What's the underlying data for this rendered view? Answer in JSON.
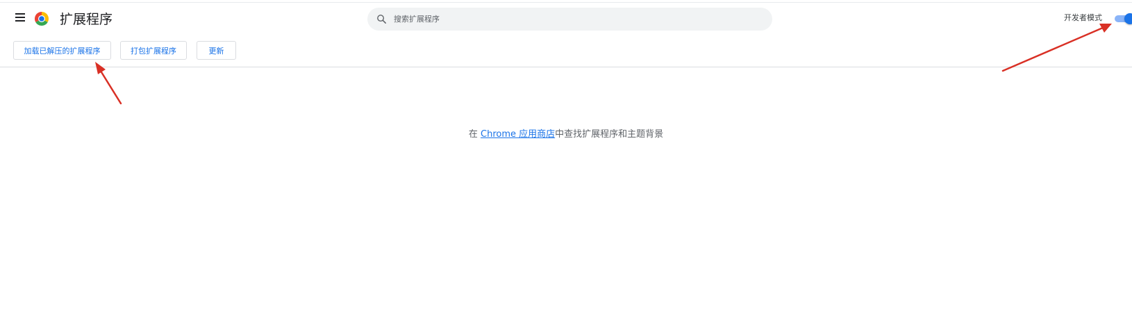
{
  "header": {
    "title": "扩展程序",
    "icons": {
      "menu": "hamburger-menu-icon",
      "logo": "chrome-logo-icon",
      "search": "search-icon"
    }
  },
  "search": {
    "placeholder": "搜索扩展程序",
    "value": ""
  },
  "developer_mode": {
    "label": "开发者模式",
    "enabled": true
  },
  "toolbar": {
    "load_unpacked_label": "加载已解压的扩展程序",
    "pack_label": "打包扩展程序",
    "update_label": "更新"
  },
  "empty_state": {
    "prefix": "在 ",
    "link_text": "Chrome 应用商店",
    "suffix": "中查找扩展程序和主题背景"
  },
  "colors": {
    "accent": "#1a73e8",
    "toggle_track": "#8ab4f8",
    "annotation_arrow": "#d93025",
    "search_bg": "#f1f3f4"
  }
}
